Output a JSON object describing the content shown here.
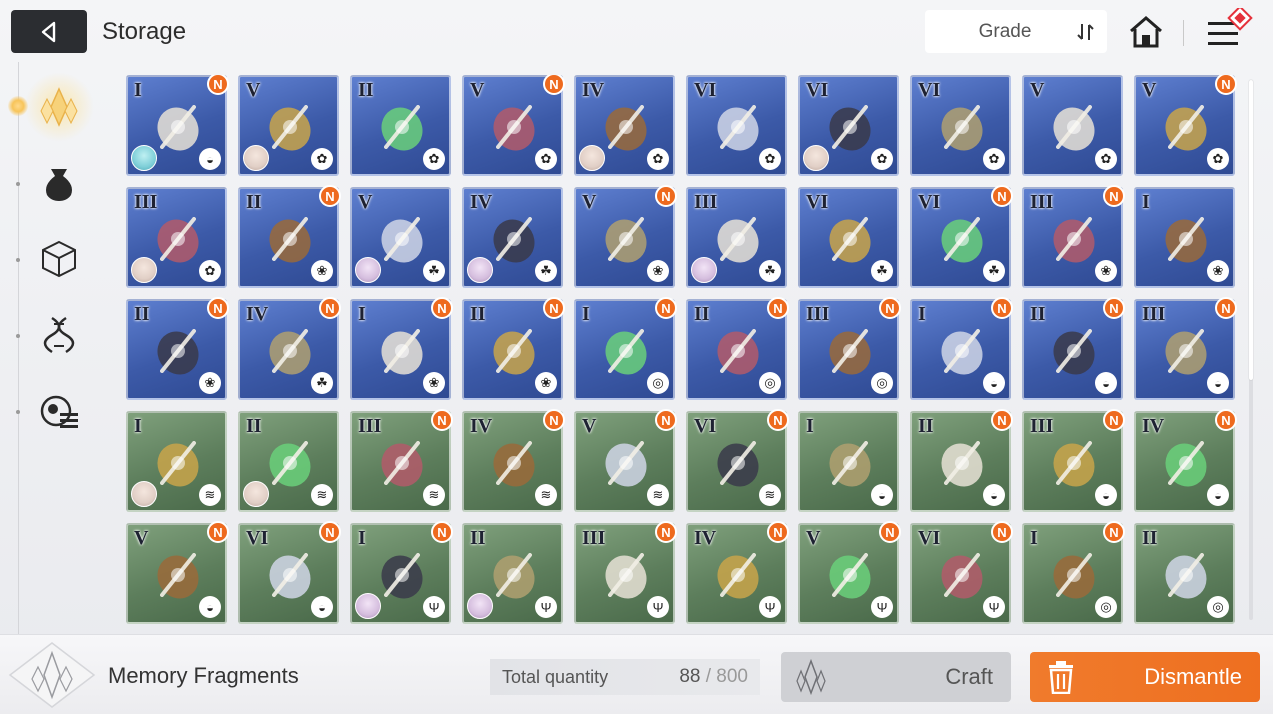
{
  "header": {
    "title": "Storage",
    "grade_label": "Grade"
  },
  "colors": {
    "blue_card": "#3c5aa8",
    "green_card": "#5d7e5c",
    "badge": "#ee6a1e",
    "dismantle": "#ef7426",
    "header_dark": "#2b2d31"
  },
  "sidebar": {
    "items": [
      {
        "icon": "memory-fragment-icon",
        "active": true
      },
      {
        "icon": "bag-icon",
        "active": false
      },
      {
        "icon": "cube-icon",
        "active": false
      },
      {
        "icon": "dna-icon",
        "active": false
      },
      {
        "icon": "module-icon",
        "active": false
      }
    ]
  },
  "grid": {
    "rows": [
      [
        {
          "grade": "I",
          "color": "blue",
          "new": true,
          "avatar": "teal",
          "type": "swirl"
        },
        {
          "grade": "V",
          "color": "blue",
          "new": false,
          "avatar": "white",
          "type": "flower"
        },
        {
          "grade": "II",
          "color": "blue",
          "new": false,
          "avatar": "",
          "type": "flower"
        },
        {
          "grade": "V",
          "color": "blue",
          "new": true,
          "avatar": "",
          "type": "flower"
        },
        {
          "grade": "IV",
          "color": "blue",
          "new": false,
          "avatar": "white",
          "type": "flower"
        },
        {
          "grade": "VI",
          "color": "blue",
          "new": false,
          "avatar": "",
          "type": "flower"
        },
        {
          "grade": "VI",
          "color": "blue",
          "new": false,
          "avatar": "white",
          "type": "flower"
        },
        {
          "grade": "VI",
          "color": "blue",
          "new": false,
          "avatar": "",
          "type": "flower"
        },
        {
          "grade": "V",
          "color": "blue",
          "new": false,
          "avatar": "",
          "type": "flower"
        },
        {
          "grade": "V",
          "color": "blue",
          "new": true,
          "avatar": "",
          "type": "flower"
        }
      ],
      [
        {
          "grade": "III",
          "color": "blue",
          "new": false,
          "avatar": "white",
          "type": "flower"
        },
        {
          "grade": "II",
          "color": "blue",
          "new": true,
          "avatar": "",
          "type": "lotus"
        },
        {
          "grade": "V",
          "color": "blue",
          "new": false,
          "avatar": "lilac",
          "type": "leaf"
        },
        {
          "grade": "IV",
          "color": "blue",
          "new": false,
          "avatar": "lilac",
          "type": "leaf"
        },
        {
          "grade": "V",
          "color": "blue",
          "new": true,
          "avatar": "",
          "type": "lotus"
        },
        {
          "grade": "III",
          "color": "blue",
          "new": false,
          "avatar": "lilac",
          "type": "leaf"
        },
        {
          "grade": "VI",
          "color": "blue",
          "new": false,
          "avatar": "",
          "type": "leaf"
        },
        {
          "grade": "VI",
          "color": "blue",
          "new": true,
          "avatar": "",
          "type": "leaf"
        },
        {
          "grade": "III",
          "color": "blue",
          "new": true,
          "avatar": "",
          "type": "lotus"
        },
        {
          "grade": "I",
          "color": "blue",
          "new": false,
          "avatar": "",
          "type": "lotus"
        }
      ],
      [
        {
          "grade": "II",
          "color": "blue",
          "new": true,
          "avatar": "",
          "type": "lotus"
        },
        {
          "grade": "IV",
          "color": "blue",
          "new": true,
          "avatar": "",
          "type": "leaf"
        },
        {
          "grade": "I",
          "color": "blue",
          "new": true,
          "avatar": "",
          "type": "lotus"
        },
        {
          "grade": "II",
          "color": "blue",
          "new": true,
          "avatar": "",
          "type": "lotus"
        },
        {
          "grade": "I",
          "color": "blue",
          "new": true,
          "avatar": "",
          "type": "wave"
        },
        {
          "grade": "II",
          "color": "blue",
          "new": true,
          "avatar": "",
          "type": "wave"
        },
        {
          "grade": "III",
          "color": "blue",
          "new": true,
          "avatar": "",
          "type": "wave"
        },
        {
          "grade": "I",
          "color": "blue",
          "new": true,
          "avatar": "",
          "type": "swirl"
        },
        {
          "grade": "II",
          "color": "blue",
          "new": true,
          "avatar": "",
          "type": "swirl"
        },
        {
          "grade": "III",
          "color": "blue",
          "new": true,
          "avatar": "",
          "type": "swirl"
        }
      ],
      [
        {
          "grade": "I",
          "color": "green",
          "new": false,
          "avatar": "white",
          "type": "wing"
        },
        {
          "grade": "II",
          "color": "green",
          "new": false,
          "avatar": "white",
          "type": "wing"
        },
        {
          "grade": "III",
          "color": "green",
          "new": true,
          "avatar": "",
          "type": "wing"
        },
        {
          "grade": "IV",
          "color": "green",
          "new": true,
          "avatar": "",
          "type": "wing"
        },
        {
          "grade": "V",
          "color": "green",
          "new": true,
          "avatar": "",
          "type": "wing"
        },
        {
          "grade": "VI",
          "color": "green",
          "new": true,
          "avatar": "",
          "type": "wing"
        },
        {
          "grade": "I",
          "color": "green",
          "new": false,
          "avatar": "",
          "type": "swirl"
        },
        {
          "grade": "II",
          "color": "green",
          "new": true,
          "avatar": "",
          "type": "swirl"
        },
        {
          "grade": "III",
          "color": "green",
          "new": true,
          "avatar": "",
          "type": "swirl"
        },
        {
          "grade": "IV",
          "color": "green",
          "new": true,
          "avatar": "",
          "type": "swirl"
        }
      ],
      [
        {
          "grade": "V",
          "color": "green",
          "new": true,
          "avatar": "",
          "type": "swirl"
        },
        {
          "grade": "VI",
          "color": "green",
          "new": true,
          "avatar": "",
          "type": "swirl"
        },
        {
          "grade": "I",
          "color": "green",
          "new": true,
          "avatar": "lilac",
          "type": "trident"
        },
        {
          "grade": "II",
          "color": "green",
          "new": false,
          "avatar": "lilac",
          "type": "trident"
        },
        {
          "grade": "III",
          "color": "green",
          "new": true,
          "avatar": "",
          "type": "trident"
        },
        {
          "grade": "IV",
          "color": "green",
          "new": true,
          "avatar": "",
          "type": "trident"
        },
        {
          "grade": "V",
          "color": "green",
          "new": true,
          "avatar": "",
          "type": "trident"
        },
        {
          "grade": "VI",
          "color": "green",
          "new": true,
          "avatar": "",
          "type": "trident"
        },
        {
          "grade": "I",
          "color": "green",
          "new": true,
          "avatar": "",
          "type": "wave"
        },
        {
          "grade": "II",
          "color": "green",
          "new": false,
          "avatar": "",
          "type": "wave"
        }
      ]
    ]
  },
  "footer": {
    "label": "Memory Fragments",
    "total_label": "Total quantity",
    "total_value": "88",
    "total_sep": " / ",
    "total_max": "800",
    "craft_label": "Craft",
    "dismantle_label": "Dismantle"
  }
}
